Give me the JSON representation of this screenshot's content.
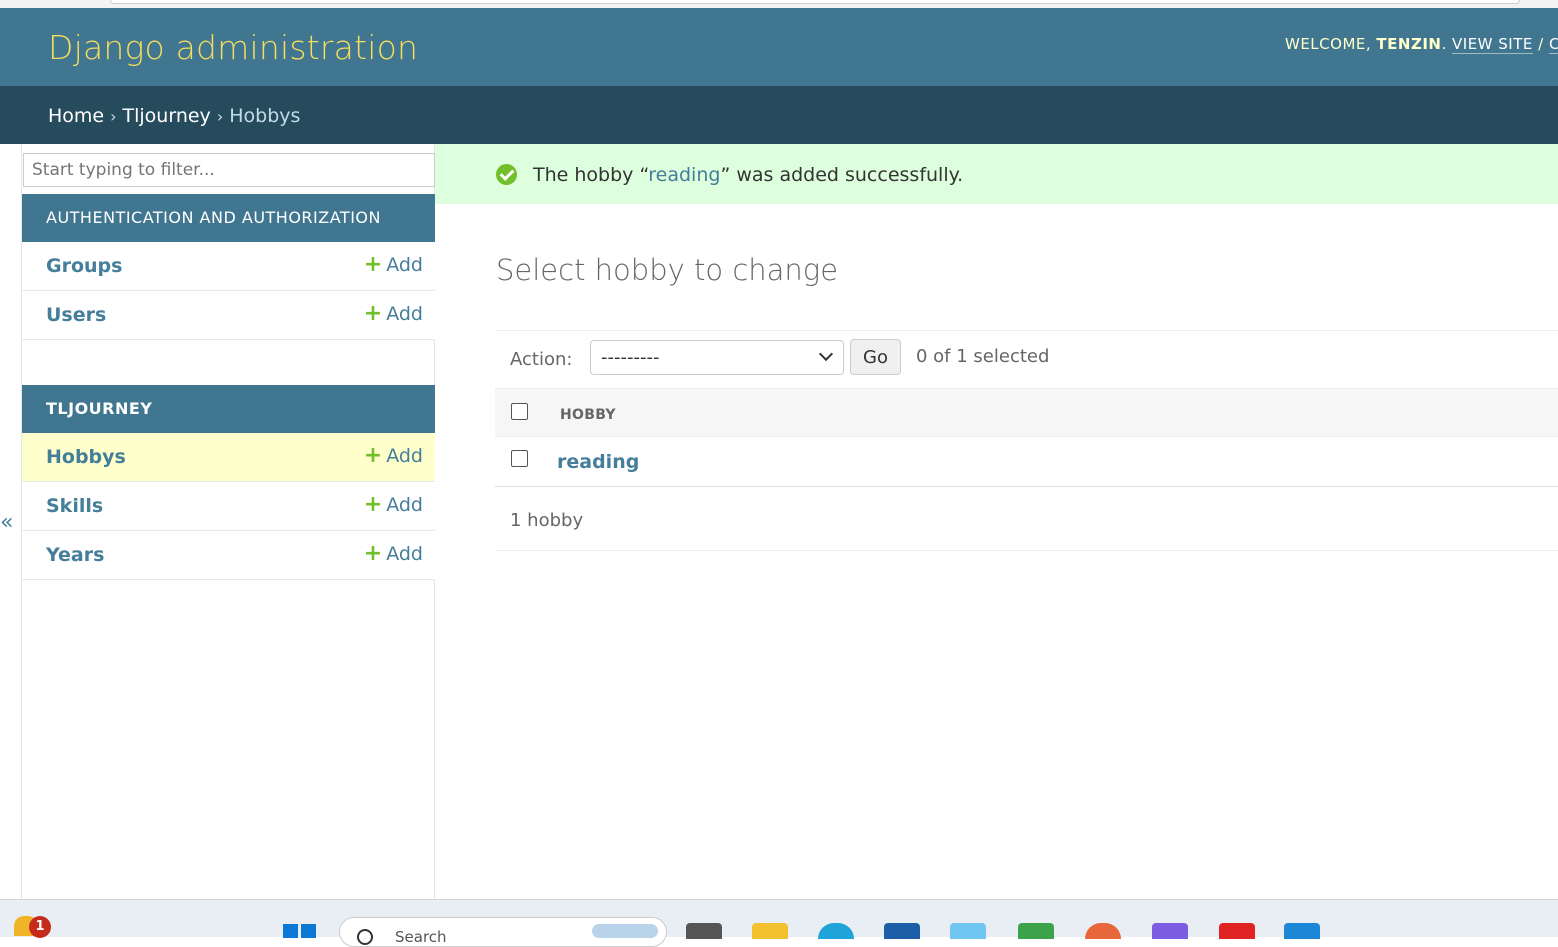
{
  "header": {
    "branding": "Django administration",
    "welcome": "WELCOME,",
    "username": "TENZIN",
    "view_site": "VIEW SITE",
    "separator": "/",
    "change_password": "CH"
  },
  "breadcrumbs": {
    "home": "Home",
    "app": "Tljourney",
    "current": "Hobbys",
    "sep": "›"
  },
  "sidebar": {
    "filter_placeholder": "Start typing to filter...",
    "add_label": "Add",
    "modules": [
      {
        "caption": "AUTHENTICATION AND AUTHORIZATION",
        "models": [
          "Groups",
          "Users"
        ]
      },
      {
        "caption": "TLJOURNEY",
        "models": [
          "Hobbys",
          "Skills",
          "Years"
        ]
      }
    ],
    "collapse_label": "«"
  },
  "message": {
    "prefix": "The hobby “",
    "object": "reading",
    "suffix": "” was added successfully."
  },
  "content": {
    "title": "Select hobby to change",
    "action_label": "Action:",
    "action_selected": "---------",
    "go_label": "Go",
    "counter": "0 of 1 selected",
    "column_header": "HOBBY",
    "rows": [
      "reading"
    ],
    "paginator": "1 hobby"
  },
  "taskbar": {
    "notification_count": "1",
    "search_text": "Search"
  },
  "colors": {
    "header_bg": "#417690",
    "breadcrumb_bg": "#264b5d",
    "branding": "#f5dd5d",
    "link": "#447e9b",
    "success_bg": "#ddffdd",
    "add_plus": "#70bf2b",
    "current_row": "#ffffcc"
  }
}
